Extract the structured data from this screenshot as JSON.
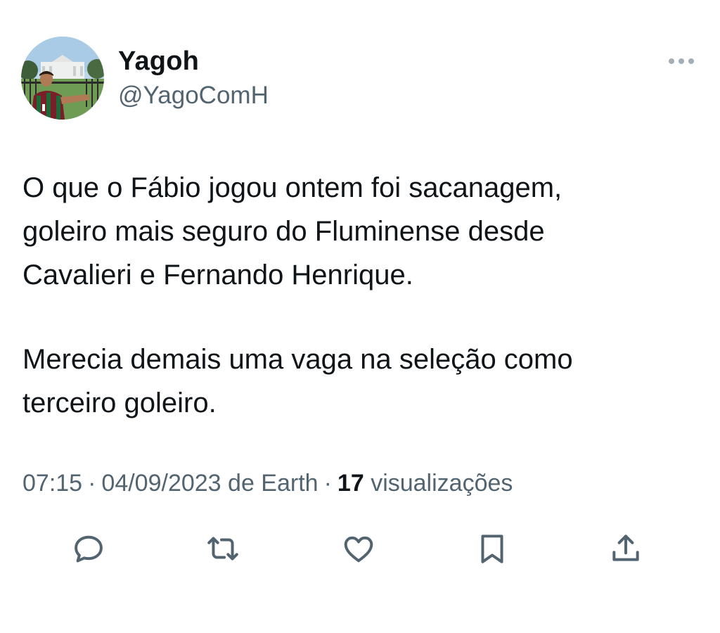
{
  "author": {
    "display_name": "Yagoh",
    "handle": "@YagoComH",
    "avatar_icon": "profile-photo"
  },
  "tweet": {
    "paragraphs": [
      "O que o Fábio jogou ontem foi sacanagem,\ngoleiro mais seguro do Fluminense desde\nCavalieri e Fernando Henrique.",
      "Merecia demais uma vaga na seleção como\nterceiro goleiro."
    ]
  },
  "meta": {
    "time": "07:15",
    "date": "04/09/2023",
    "source": "de Earth",
    "views_count": "17",
    "views_label": "visualizações",
    "separator": "·"
  },
  "actions": [
    {
      "name": "reply",
      "icon": "speech-bubble-icon"
    },
    {
      "name": "retweet",
      "icon": "retweet-arrows-icon"
    },
    {
      "name": "like",
      "icon": "heart-icon"
    },
    {
      "name": "bookmark",
      "icon": "bookmark-icon"
    },
    {
      "name": "share",
      "icon": "share-upload-icon"
    }
  ],
  "colors": {
    "text_primary": "#0f1419",
    "text_secondary": "#536471",
    "icon": "#536471",
    "background": "#ffffff"
  }
}
